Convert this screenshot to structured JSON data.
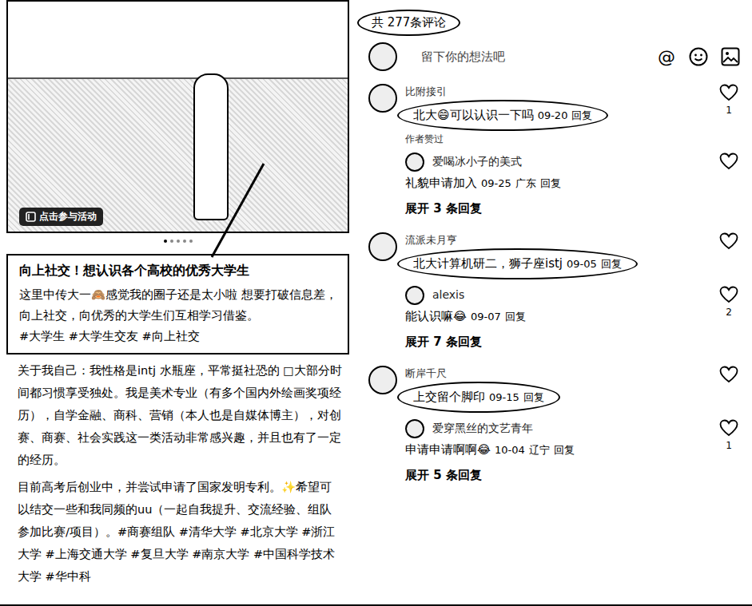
{
  "post": {
    "badge": "点击参与活动",
    "dots": [
      {
        "selected": true
      },
      {
        "selected": false
      },
      {
        "selected": false
      },
      {
        "selected": false
      },
      {
        "selected": false
      }
    ],
    "caption": {
      "title": "向上社交！想认识各个高校的优秀大学生",
      "body": "这里中传大一🙈感觉我的圈子还是太小啦 想要打破信息差，向上社交，向优秀的大学生们互相学习借鉴。",
      "tags": "#大学生 #大学生交友 #向上社交"
    },
    "paragraphs": [
      "关于我自己：我性格是intj 水瓶座，平常挺社恐的 □大部分时间都习惯享受独处。我是美术专业（有多个国内外绘画奖项经历），自学金融、商科、营销（本人也是自媒体博主），对创赛、商赛、社会实践这一类活动非常感兴趣，并且也有了一定的经历。",
      "目前高考后创业中，并尝试申请了国家发明专利。✨希望可以结交一些和我同频的uu（一起自我提升、交流经验、组队参加比赛/项目）。#商赛组队 #清华大学 #北京大学 #浙江大学 #上海交通大学 #复旦大学 #南京大学 #中国科学技术大学 #华中科"
    ]
  },
  "comments_header": {
    "count": "共 277条评论",
    "circled": true
  },
  "input": {
    "placeholder": "留下你的想法吧",
    "mention": "@"
  },
  "comments": [
    {
      "user": "比附接引",
      "text": "北大😄可以认识一下吗",
      "time": "09-20",
      "reply_label": "回复",
      "tag": "作者赞过",
      "likes": "1",
      "circled": true,
      "reply": {
        "user": "爱喝冰小子的美式",
        "text": "礼貌申请加入",
        "time": "09-25",
        "location": "广东",
        "reply_label": "回复",
        "likes": null
      },
      "expand": "展开 3 条回复"
    },
    {
      "user": "流派未月亨",
      "text": "北大计算机研二，狮子座istj",
      "time": "09-05",
      "reply_label": "回复",
      "tag": null,
      "likes": null,
      "circled": true,
      "reply": {
        "user": "alexis",
        "text": "能认识嘛😂",
        "time": "09-07",
        "location": null,
        "reply_label": "回复",
        "likes": "2"
      },
      "expand": "展开 7 条回复"
    },
    {
      "user": "断岸千尺",
      "text": "上交留个脚印",
      "time": "09-15",
      "reply_label": "回复",
      "tag": null,
      "likes": null,
      "circled": true,
      "reply": {
        "user": "爱穿黑丝的文艺青年",
        "text": "申请申请啊啊😂",
        "time": "10-04",
        "location": "辽宁",
        "reply_label": "回复",
        "likes": "1"
      },
      "expand": "展开 5 条回复"
    }
  ]
}
